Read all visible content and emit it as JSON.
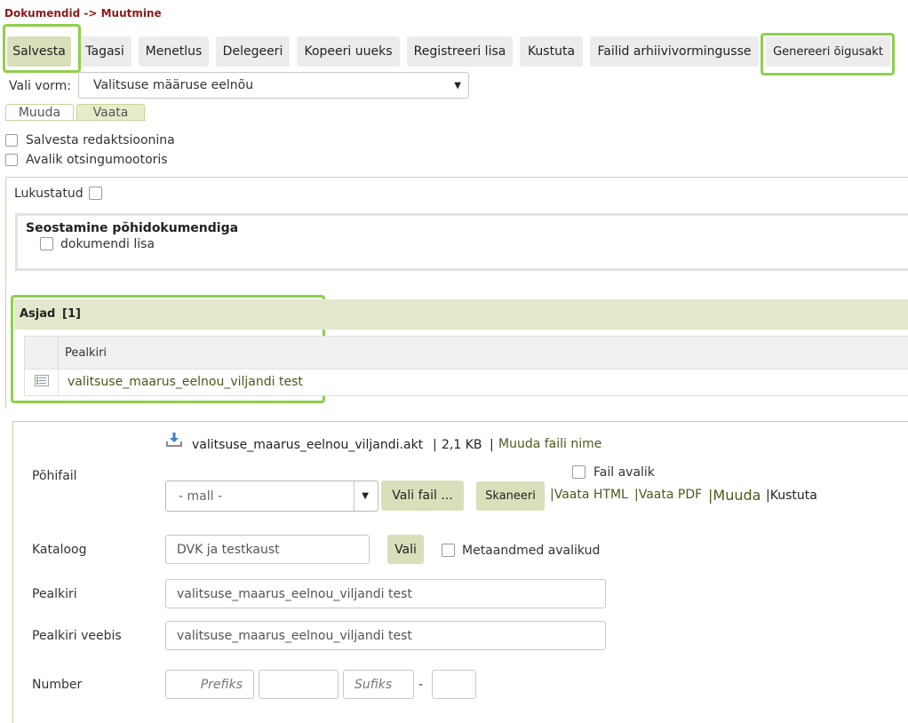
{
  "breadcrumb": "Dokumendid -> Muutmine",
  "toolbar": {
    "save": "Salvesta",
    "back": "Tagasi",
    "procedure": "Menetlus",
    "delegate": "Delegeeri",
    "copy_new": "Kopeeri uueks",
    "register_attachment": "Registreeri lisa",
    "delete": "Kustuta",
    "archive_files": "Failid arhiivivormingusse",
    "generate_legal_act": "Genereeri õigusakt"
  },
  "form_select": {
    "label": "Vali vorm:",
    "value": "Valitsuse määruse eelnõu"
  },
  "tabs": {
    "edit": "Muuda",
    "view": "Vaata"
  },
  "options": {
    "save_as_revision": "Salvesta redaktsioonina",
    "public_in_search": "Avalik otsingumootoris"
  },
  "locked_label": "Lukustatud",
  "linking": {
    "title": "Seostamine põhidokumendiga",
    "attachment_label": "dokumendi lisa"
  },
  "cases": {
    "title": "Asjad",
    "count": "[1]",
    "column_title": "Pealkiri",
    "rows": [
      {
        "title": "valitsuse_maarus_eelnou_viljandi test"
      }
    ]
  },
  "main_file": {
    "label": "Põhifail",
    "file_name": "valitsuse_maarus_eelnou_viljandi.akt",
    "separator": "|",
    "file_size": "2,1 KB",
    "rename_link": "Muuda faili nime",
    "public_label": "Fail avalik",
    "template_placeholder": "- mall -",
    "choose_file": "Vali fail ...",
    "scan": "Skaneeri",
    "view_html": "|Vaata HTML",
    "view_pdf": "|Vaata PDF",
    "edit": "|Muuda",
    "delete": "|Kustuta"
  },
  "catalog": {
    "label": "Kataloog",
    "value": "DVK ja testkaust",
    "choose": "Vali",
    "metadata_public": "Metaandmed avalikud"
  },
  "title_field": {
    "label": "Pealkiri",
    "value": "valitsuse_maarus_eelnou_viljandi test"
  },
  "web_title_field": {
    "label": "Pealkiri veebis",
    "value": "valitsuse_maarus_eelnou_viljandi test"
  },
  "number": {
    "label": "Number",
    "prefix_placeholder": "Prefiks",
    "suffix_placeholder": "Sufiks",
    "dash": "-"
  },
  "colors": {
    "breadcrumb": "#8b1a1a",
    "highlight": "#8fcf4c",
    "accent_button": "#d9dfba",
    "section_header": "#e3e8cc"
  }
}
